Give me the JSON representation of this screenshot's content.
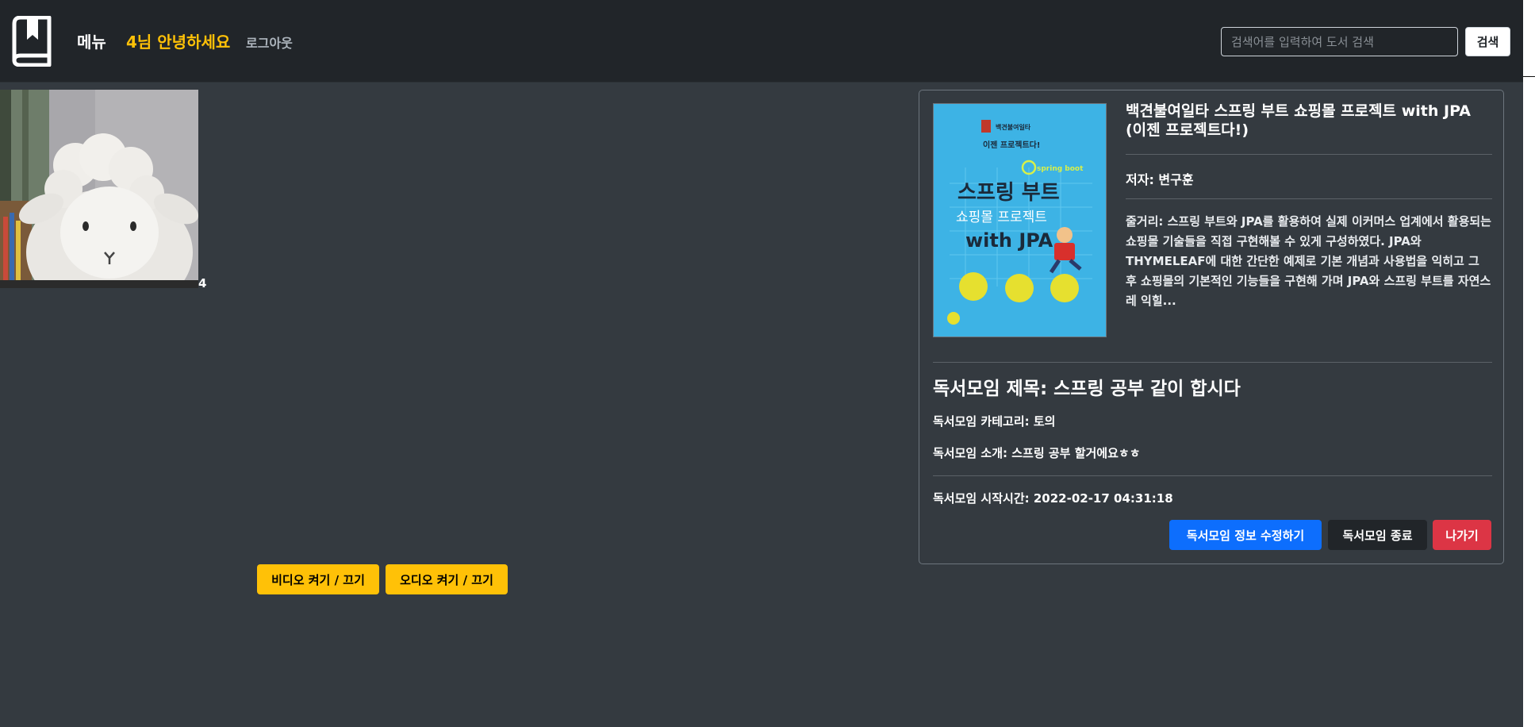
{
  "navbar": {
    "menu_label": "메뉴",
    "greeting": "4님 안녕하세요",
    "logout_label": "로그아웃",
    "search_placeholder": "검색어를 입력하여 도서 검색",
    "search_value": "",
    "search_button": "검색",
    "logo_icon": "book-bookmark-icon"
  },
  "video": {
    "participant_label": "4",
    "video_toggle": "비디오 켜기 / 끄기",
    "audio_toggle": "오디오 켜기 / 끄기"
  },
  "book": {
    "cover": {
      "series_top": "백견불여일타",
      "tagline": "이젠 프로젝트다!",
      "badge": "spring boot",
      "title_line1": "스프링 부트",
      "title_line2": "쇼핑몰 프로젝트",
      "title_line3": "with JPA"
    },
    "title": "백견불여일타 스프링 부트 쇼핑몰 프로젝트 with JPA (이젠 프로젝트다!)",
    "author": "저자: 변구훈",
    "summary": "줄거리: 스프링 부트와 JPA를 활용하여 실제 이커머스 업계에서 활용되는 쇼핑몰 기술들을 직접 구현해볼 수 있게 구성하였다. JPA와 THYMELEAF에 대한 간단한 예제로 기본 개념과 사용법을 익히고 그 후 쇼핑몰의 기본적인 기능들을 구현해 가며 JPA와 스프링 부트를 자연스레 익힐..."
  },
  "club": {
    "title": "독서모임 제목: 스프링 공부 같이 합시다",
    "category": "독서모임 카테고리: 토의",
    "intro": "독서모임 소개: 스프링 공부 할거에요ㅎㅎ",
    "start_time": "독서모임 시작시간: 2022-02-17 04:31:18"
  },
  "actions": {
    "edit": "독서모임 정보 수정하기",
    "end": "독서모임 종료",
    "exit": "나가기"
  },
  "colors": {
    "background": "#343a40",
    "navbar": "#212529",
    "accent_yellow": "#ffc107",
    "primary_blue": "#0d6efd",
    "danger_red": "#dc3545"
  }
}
